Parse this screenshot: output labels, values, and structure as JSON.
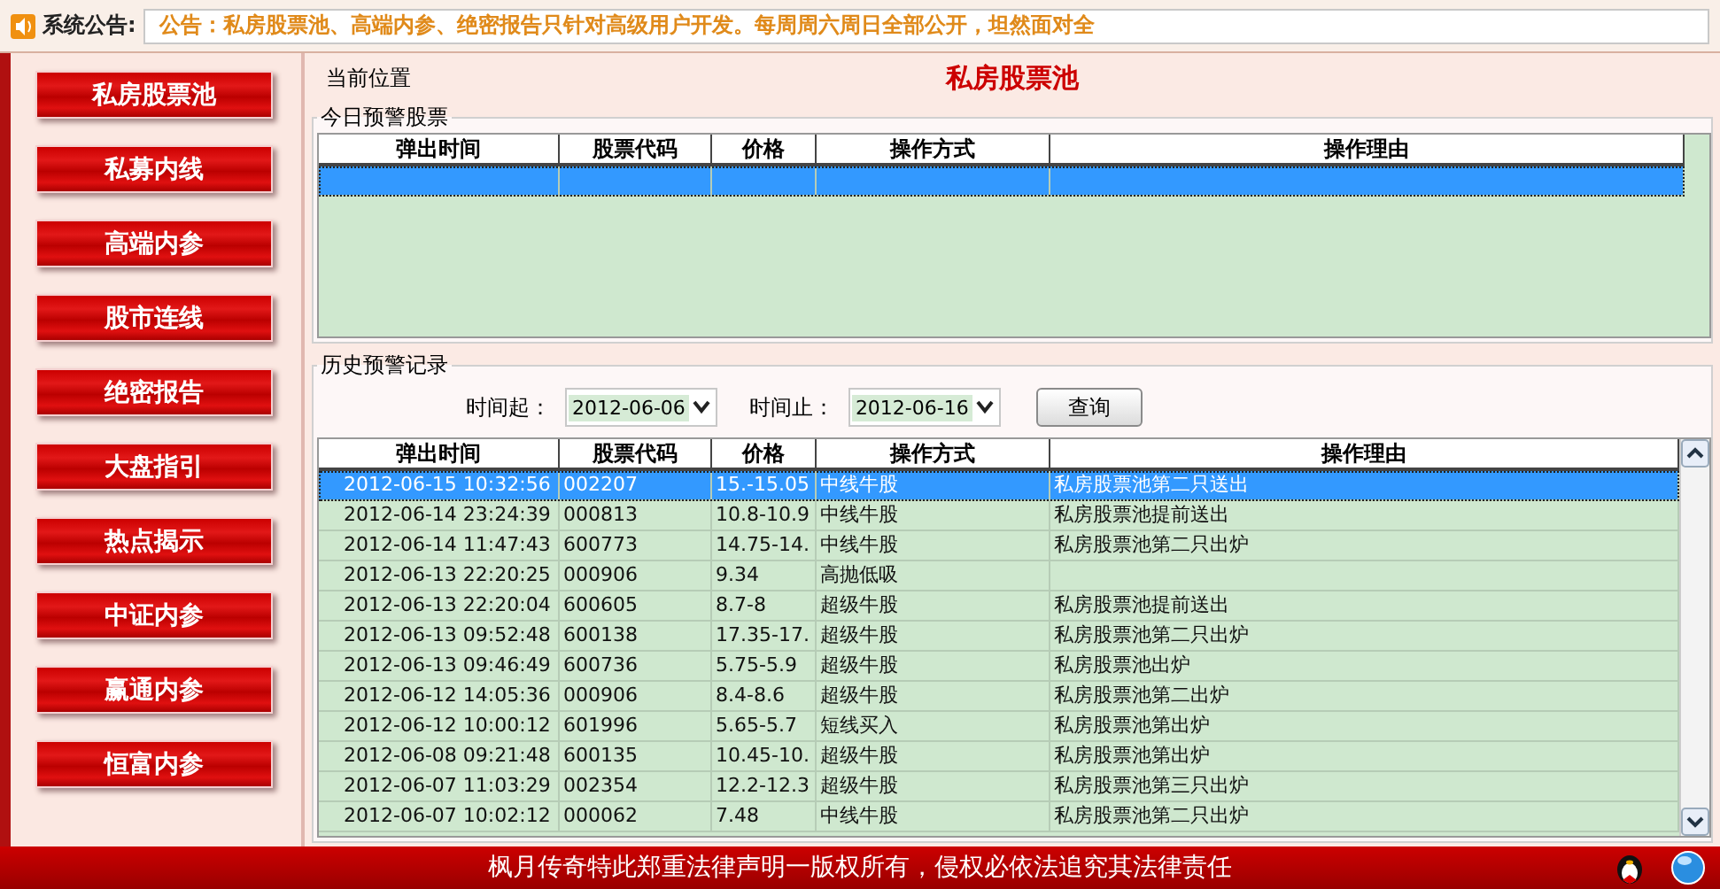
{
  "notice_bar": {
    "label": "系统公告:",
    "text": "公告：私房股票池、高端内参、绝密报告只针对高级用户开发。每周周六周日全部公开，坦然面对全"
  },
  "sidebar": {
    "items": [
      {
        "label": "私房股票池"
      },
      {
        "label": "私募内线"
      },
      {
        "label": "高端内参"
      },
      {
        "label": "股市连线"
      },
      {
        "label": "绝密报告"
      },
      {
        "label": "大盘指引"
      },
      {
        "label": "热点揭示"
      },
      {
        "label": "中证内参"
      },
      {
        "label": "赢通内参"
      },
      {
        "label": "恒富内参"
      }
    ]
  },
  "location": {
    "label": "当前位置",
    "title": "私房股票池"
  },
  "today_panel": {
    "title": "今日预警股票",
    "columns": [
      "弹出时间",
      "股票代码",
      "价格",
      "操作方式",
      "操作理由"
    ],
    "rows": [
      {
        "selected": true
      }
    ]
  },
  "history_panel": {
    "title": "历史预警记录",
    "from_label": "时间起：",
    "from_value": "2012-06-06",
    "to_label": "时间止：",
    "to_value": "2012-06-16",
    "query_button": "查询",
    "columns": [
      "弹出时间",
      "股票代码",
      "价格",
      "操作方式",
      "操作理由"
    ],
    "rows": [
      {
        "selected": true,
        "cells": [
          "2012-06-15 10:32:56",
          "002207",
          "15.-15.05",
          "中线牛股",
          "私房股票池第二只送出"
        ]
      },
      {
        "selected": false,
        "cells": [
          "2012-06-14 23:24:39",
          "000813",
          "10.8-10.9",
          "中线牛股",
          "私房股票池提前送出"
        ]
      },
      {
        "selected": false,
        "cells": [
          "2012-06-14 11:47:43",
          "600773",
          "14.75-14.",
          "中线牛股",
          "私房股票池第二只出炉"
        ]
      },
      {
        "selected": false,
        "cells": [
          "2012-06-13 22:20:25",
          "000906",
          "9.34",
          "高抛低吸",
          ""
        ]
      },
      {
        "selected": false,
        "cells": [
          "2012-06-13 22:20:04",
          "600605",
          "8.7-8",
          "超级牛股",
          "私房股票池提前送出"
        ]
      },
      {
        "selected": false,
        "cells": [
          "2012-06-13 09:52:48",
          "600138",
          "17.35-17.",
          "超级牛股",
          "私房股票池第二只出炉"
        ]
      },
      {
        "selected": false,
        "cells": [
          "2012-06-13 09:46:49",
          "600736",
          "5.75-5.9",
          "超级牛股",
          "私房股票池出炉"
        ]
      },
      {
        "selected": false,
        "cells": [
          "2012-06-12 14:05:36",
          "000906",
          "8.4-8.6",
          "超级牛股",
          "私房股票池第二出炉"
        ]
      },
      {
        "selected": false,
        "cells": [
          "2012-06-12 10:00:12",
          "601996",
          "5.65-5.7",
          "短线买入",
          "私房股票池第出炉"
        ]
      },
      {
        "selected": false,
        "cells": [
          "2012-06-08 09:21:48",
          "600135",
          "10.45-10.",
          "超级牛股",
          "私房股票池第出炉"
        ]
      },
      {
        "selected": false,
        "cells": [
          "2012-06-07 11:03:29",
          "002354",
          "12.2-12.3",
          "超级牛股",
          "私房股票池第三只出炉"
        ]
      },
      {
        "selected": false,
        "cells": [
          "2012-06-07 10:02:12",
          "000062",
          "7.48",
          "中线牛股",
          "私房股票池第二只出炉"
        ]
      }
    ]
  },
  "footer": {
    "text": "枫月传奇特此郑重法律声明一版权所有，侵权必依法追究其法律责任"
  }
}
